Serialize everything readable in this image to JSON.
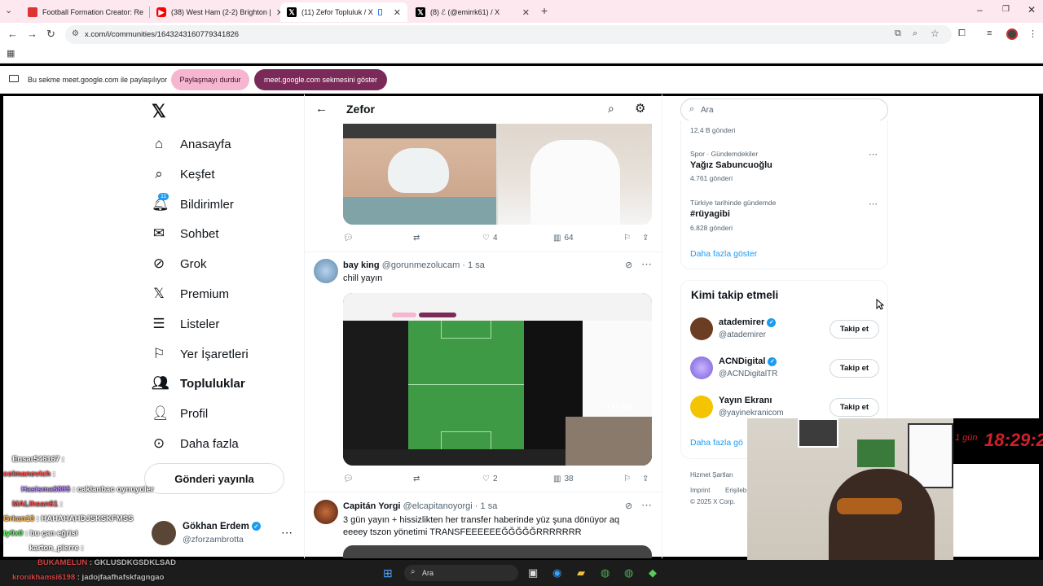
{
  "browser": {
    "tabs": [
      {
        "title": "Football Formation Creator: Re",
        "icon": "ff-icon",
        "color": "#d33"
      },
      {
        "title": "(38) West Ham (2-2) Brighton |",
        "icon": "youtube-icon",
        "color": "#f00"
      },
      {
        "title": "(11) Zefor Topluluk / X",
        "icon": "x-icon",
        "color": "#000"
      },
      {
        "title": "(8) ℰ (@emirrk61) / X",
        "icon": "x-icon",
        "color": "#000"
      }
    ],
    "new_tab": "+",
    "url": "x.com/i/communities/1643243160779341826"
  },
  "sharebar": {
    "message": "Bu sekme meet.google.com ile paylaşılıyor",
    "stop_label": "Paylaşmayı durdur",
    "show_label": "meet.google.com sekmesini göster"
  },
  "nav": {
    "items": [
      {
        "label": "Anasayfa",
        "icon": "home-icon"
      },
      {
        "label": "Keşfet",
        "icon": "search-icon"
      },
      {
        "label": "Bildirimler",
        "icon": "bell-icon",
        "badge": "11"
      },
      {
        "label": "Sohbet",
        "icon": "mail-icon"
      },
      {
        "label": "Grok",
        "icon": "grok-icon"
      },
      {
        "label": "Premium",
        "icon": "x-icon"
      },
      {
        "label": "Listeler",
        "icon": "list-icon"
      },
      {
        "label": "Yer İşaretleri",
        "icon": "bookmark-icon"
      },
      {
        "label": "Topluluklar",
        "icon": "people-icon"
      },
      {
        "label": "Profil",
        "icon": "person-icon"
      },
      {
        "label": "Daha fazla",
        "icon": "more-circle-icon"
      }
    ],
    "post_button": "Gönderi yayınla",
    "account": {
      "name": "Gökhan Erdem",
      "handle": "@zforzambrotta"
    }
  },
  "header": {
    "title": "Zefor"
  },
  "posts": [
    {
      "likes": "4",
      "views": "64"
    },
    {
      "name": "bay king",
      "handle": "@gorunmezolucam",
      "time": "· 1 sa",
      "text": "chill yayın",
      "likes": "2",
      "views": "38"
    },
    {
      "name": "Capitán Yorgi",
      "handle": "@elcapitanoyorgi",
      "time": "· 1 sa",
      "text": "3 gün yayın + hissizlikten her transfer haberinde yüz şuna dönüyor aq eeeey tszon yönetimi TRANSFEEEEEEĞĞĞĞĞRRRRRRR"
    }
  ],
  "search": {
    "placeholder": "Ara"
  },
  "trends": {
    "top_count": "12,4 B gönderi",
    "items": [
      {
        "category": "Spor · Gündemdekiler",
        "title": "Yağız Sabuncuoğlu",
        "count": "4.761 gönderi"
      },
      {
        "category": "Türkiye tarihinde gündemde",
        "title": "#rüyagibi",
        "count": "6.828 gönderi"
      }
    ],
    "show_more": "Daha fazla göster"
  },
  "who_to_follow": {
    "title": "Kimi takip etmeli",
    "accounts": [
      {
        "name": "atademirer",
        "handle": "@atademirer",
        "button": "Takip et"
      },
      {
        "name": "ACNDigital",
        "handle": "@ACNDigitalTR",
        "button": "Takip et"
      },
      {
        "name": "Yayın Ekranı",
        "handle": "@yayinekranicom",
        "button": "Takip et"
      }
    ],
    "show_more": "Daha fazla gö"
  },
  "footer": {
    "terms": "Hizmet Şartları",
    "imprint": "Imprint",
    "access": "Erişileb",
    "copyright": "© 2025 X Corp."
  },
  "overlay": {
    "clock": "18:29:2",
    "day": "1 gün",
    "logo_text": "TITAN"
  },
  "chat": [
    {
      "user": "Ensar546167",
      "msg": ":",
      "color": "#ffffff"
    },
    {
      "user": "colmanovich",
      "msg": ":",
      "color": "#ff4d4d"
    },
    {
      "user": "Hasisma6895",
      "msg": ": caklanbac oynuyoler",
      "color": "#b98cff"
    },
    {
      "user": "MALihsan61",
      "msg": ":",
      "color": "#ff4d4d"
    },
    {
      "user": "Grkan13",
      "msg": ": HAHAHAHDJSKSKFMSS",
      "color": "#ffb84d"
    },
    {
      "user": "ty0x0",
      "msg": ": bu çan eğrisi",
      "color": "#55ff55"
    },
    {
      "user": "karton_pierre",
      "msg": ":",
      "color": "#ffffff"
    },
    {
      "user": "BUKAMELUN",
      "msg": ": GKLUSDKGSDKLSAD",
      "color": "#ff4d4d"
    },
    {
      "user": "kronikhamsi6198",
      "msg": ": jadojfaafhafskfagngao",
      "color": "#ff4d4d"
    }
  ],
  "taskbar": {
    "search": "Ara"
  }
}
